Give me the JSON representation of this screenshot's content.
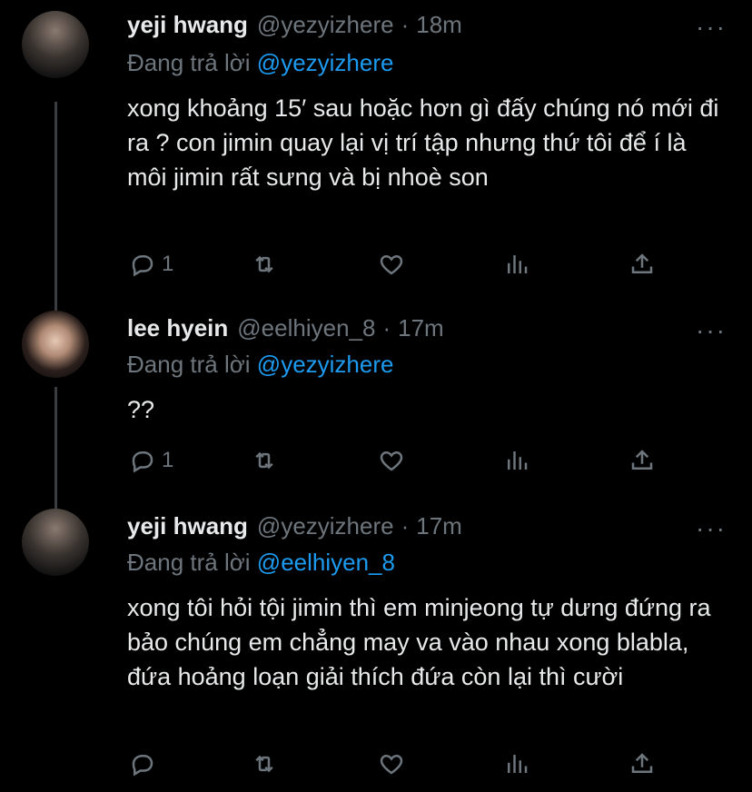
{
  "tweets": [
    {
      "name": "yeji hwang",
      "handle": "@yezyizhere",
      "dot": "·",
      "time": "18m",
      "more": "···",
      "reply_prefix": "Đang trả lời",
      "reply_to": "@yezyizhere",
      "text": "xong khoảng 15′ sau hoặc hơn gì đấy chúng nó mới đi ra ? con jimin quay lại vị trí tập nhưng thứ tôi để í là môi jimin rất sưng và bị nhoè son",
      "reply_count": "1"
    },
    {
      "name": "lee hyein",
      "handle": "@eelhiyen_8",
      "dot": "·",
      "time": "17m",
      "more": "···",
      "reply_prefix": "Đang trả lời",
      "reply_to": "@yezyizhere",
      "text": "??",
      "reply_count": "1"
    },
    {
      "name": "yeji hwang",
      "handle": "@yezyizhere",
      "dot": "·",
      "time": "17m",
      "more": "···",
      "reply_prefix": "Đang trả lời",
      "reply_to": "@eelhiyen_8",
      "text": "xong tôi hỏi tội jimin thì em minjeong tự dưng đứng ra bảo chúng em chẳng may va vào nhau xong blabla, đứa hoảng loạn giải thích đứa còn lại thì cười",
      "reply_count": ""
    }
  ],
  "icons": {
    "reply": "reply-icon",
    "retweet": "retweet-icon",
    "like": "heart-icon",
    "analytics": "analytics-icon",
    "share": "share-icon"
  },
  "colors": {
    "background": "#000000",
    "mention": "#1d9bf0",
    "secondary_text": "#6e767d",
    "primary_text": "#e7e9ea"
  }
}
